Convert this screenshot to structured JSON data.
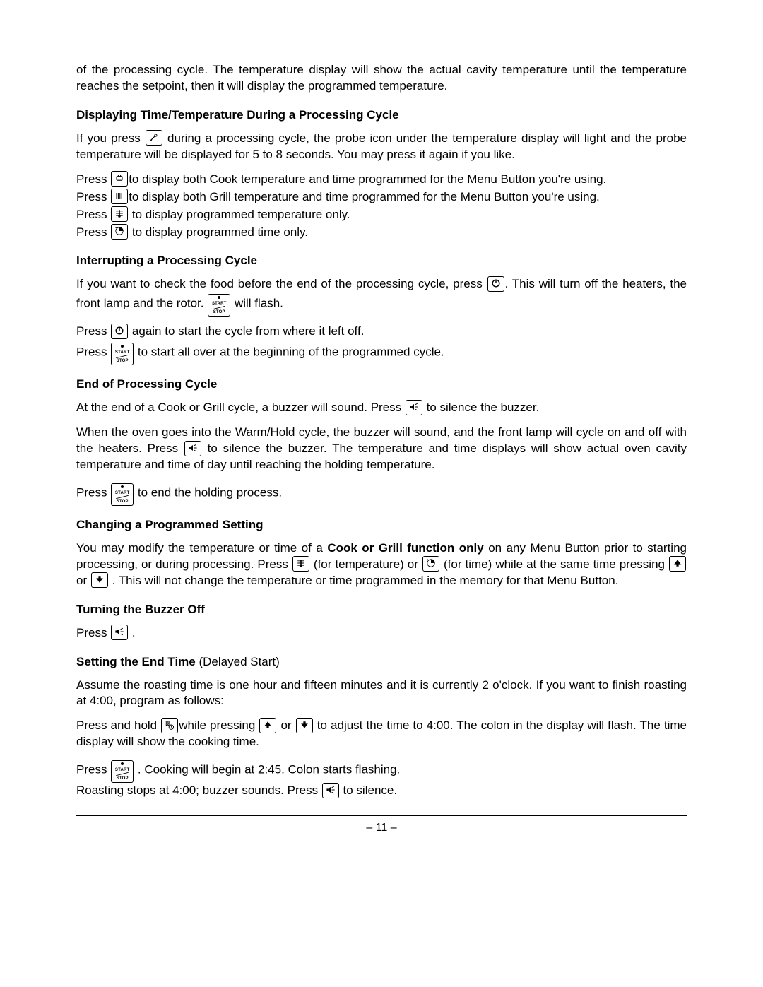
{
  "intro": "of the processing cycle.  The temperature display will show the actual cavity temperature until the temperature reaches the setpoint, then it will display the programmed temperature.",
  "h1": "Displaying Time/Temperature During a Processing Cycle",
  "p1a": "If you press ",
  "p1b": " during a processing cycle, the probe icon under the temperature display will light and the probe temperature will be displayed for 5 to 8 seconds.  You may press it again if you like.",
  "press": "Press ",
  "press_hold": "Press and hold ",
  "p2a": "to display both Cook temperature and time programmed for the Menu Button you're using.",
  "p2b": "to display both Grill temperature and time programmed for the Menu Button you're using.",
  "p2c": " to display programmed temperature only.",
  "p2d": " to display programmed time only.",
  "h2": "Interrupting a Processing Cycle",
  "p3a": "If you want to check the food before the end of the processing cycle, press ",
  "p3b": ".  This will turn off the heaters, the front lamp and the rotor.    ",
  "p3c": " will flash.",
  "p4a": " again to start the cycle from where it left off.",
  "p4b": " to start all over at the beginning of the programmed cycle.",
  "h3": "End of Processing Cycle",
  "p5": "At the end of a Cook or Grill cycle, a buzzer will sound.  Press ",
  "p5b": "  to silence the buzzer.",
  "p6a": "When the oven goes into the Warm/Hold cycle, the buzzer will sound, and the front lamp will cycle on and off with the heaters.  Press ",
  "p6b": " to silence the buzzer.  The temperature and time displays will show  actual oven cavity temperature and time of day until reaching the holding temperature.",
  "p7": " to end the holding process.",
  "h4": "Changing a Programmed Setting",
  "p8a": "You may modify the temperature or time of a ",
  "p8bold": "Cook or Grill function only",
  "p8b": " on any Menu Button prior to starting processing, or during processing.  Press ",
  "p8c": " (for temperature)  or ",
  "p8d": " (for time) while at the same time pressing ",
  "p8or": " or ",
  "p8e": " .  This will not change the temperature or time programmed in the memory for that Menu Button.",
  "h5": "Turning the Buzzer Off",
  "p9": " .",
  "h6a": "Setting the End Time",
  "h6b": " (Delayed Start)",
  "p10": "Assume the roasting time is one hour and fifteen minutes and it is currently 2 o'clock.  If you want to finish roasting at 4:00, program as follows:",
  "p11a": "while pressing ",
  "p11b": " to adjust the time to 4:00.  The colon in the display will flash.  The time display will show the cooking time.",
  "p12a": " .  Cooking will begin at 2:45.    Colon starts flashing.",
  "p12b": "Roasting stops at 4:00; buzzer sounds.  Press ",
  "p12c": " to silence.",
  "pagenum": "– 11 –",
  "icons": {
    "probe": "probe-icon",
    "cook": "cook-icon",
    "grill": "grill-icon",
    "temp": "temperature-icon",
    "time": "time-icon",
    "power": "power-icon",
    "buzzer": "buzzer-icon",
    "up": "arrow-up-icon",
    "down": "arrow-down-icon",
    "endtime": "end-time-icon",
    "startstop": "start-stop-button"
  }
}
